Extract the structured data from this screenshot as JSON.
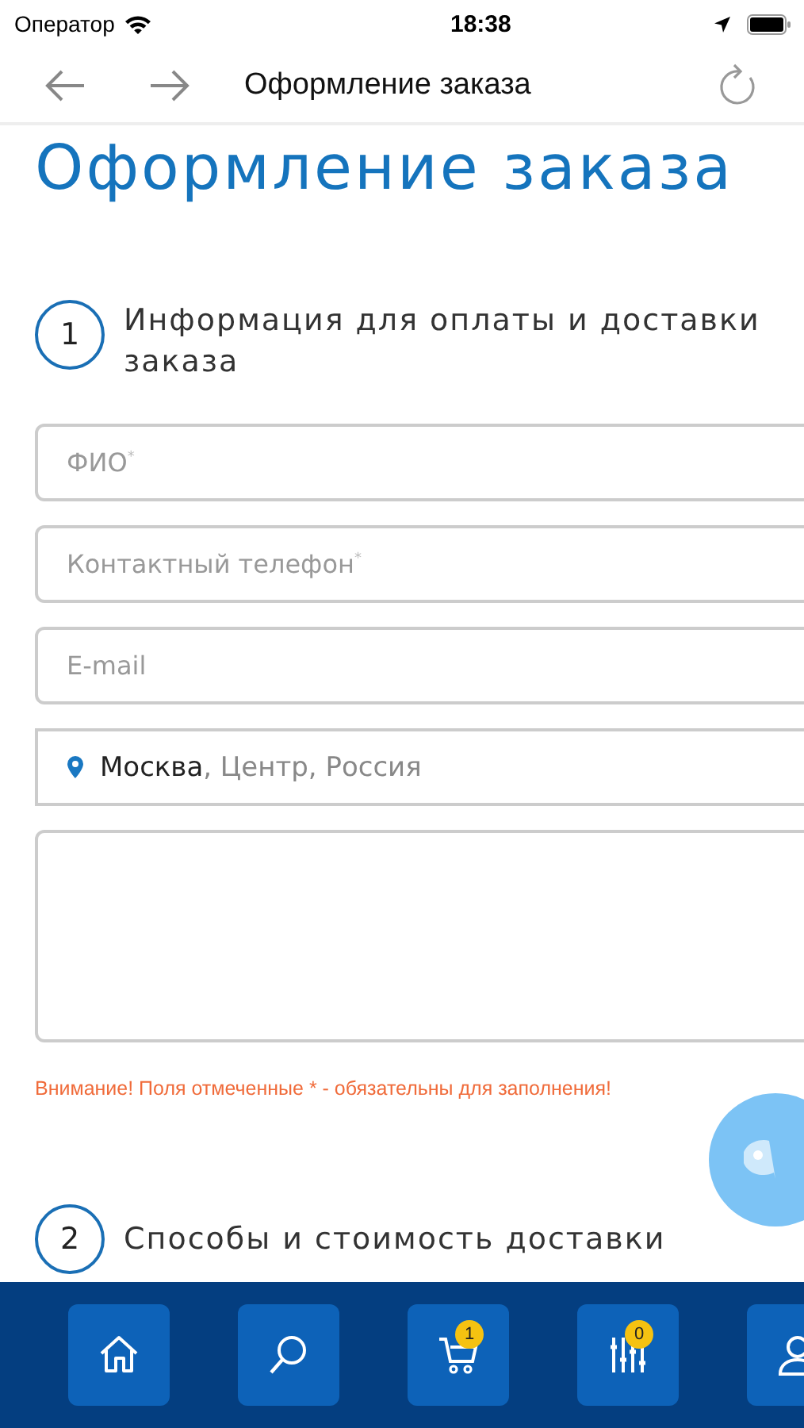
{
  "status_bar": {
    "carrier": "Оператор",
    "time": "18:38"
  },
  "nav_bar": {
    "title": "Оформление заказа"
  },
  "page_title": "Оформление заказа",
  "sections": [
    {
      "number": "1",
      "title": "Информация для оплаты и доставки заказа"
    }
  ],
  "fields": [
    {
      "kind": "text",
      "placeholder": "ФИО",
      "required_mark": "*"
    },
    {
      "kind": "text",
      "placeholder": "Контактный телефон",
      "required_mark": "*"
    },
    {
      "kind": "text",
      "placeholder": "E-mail"
    },
    {
      "kind": "location",
      "city": "Москва",
      "rest": ", Центр, Россия"
    },
    {
      "kind": "textarea"
    }
  ],
  "warning": "Внимание! Поля отмеченные * - обязательны для заполнения!",
  "next_section": {
    "number": "2",
    "title": "Способы и стоимость доставки"
  },
  "tab_bar": [
    {
      "kind": "home"
    },
    {
      "kind": "search"
    },
    {
      "kind": "cart",
      "badge": "1"
    },
    {
      "kind": "filter",
      "badge": "0"
    },
    {
      "kind": "profile"
    }
  ]
}
